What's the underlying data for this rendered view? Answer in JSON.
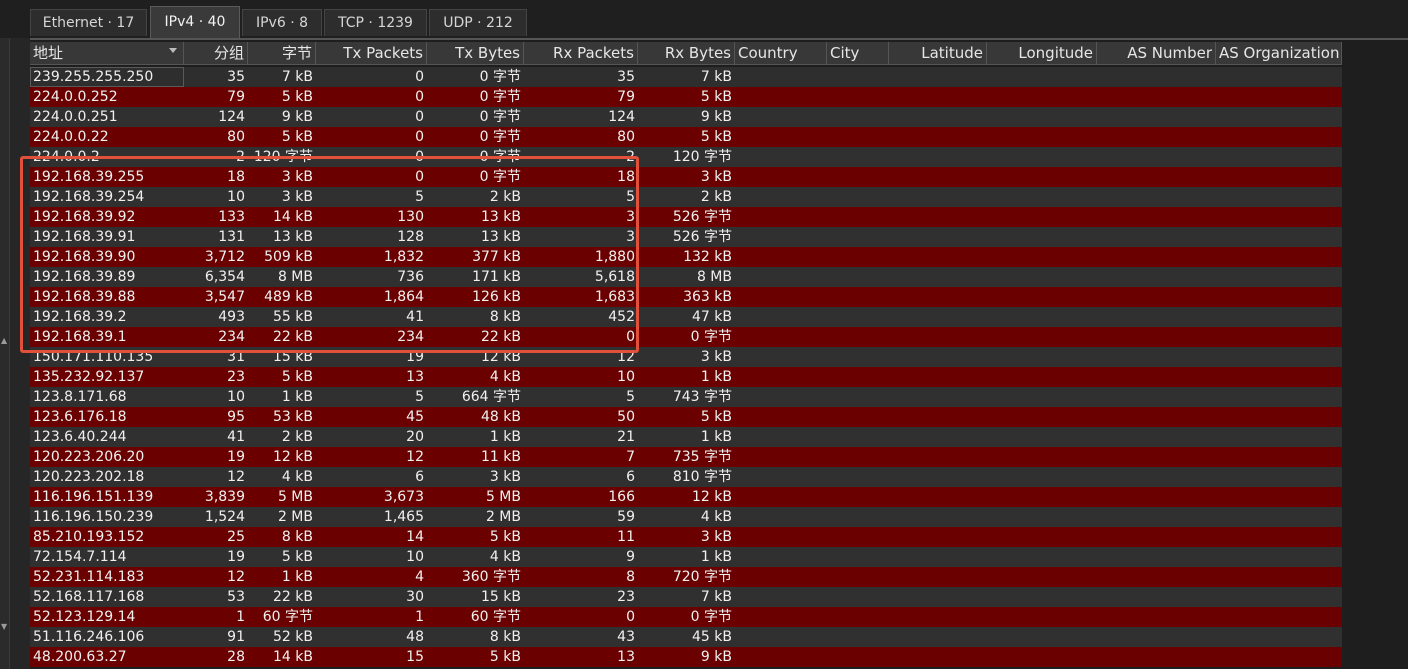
{
  "tabs": [
    {
      "label": "Ethernet · 17"
    },
    {
      "label": "IPv4 · 40"
    },
    {
      "label": "IPv6 · 8"
    },
    {
      "label": "TCP · 1239"
    },
    {
      "label": "UDP · 212"
    }
  ],
  "active_tab": "IPv4 · 40",
  "columns": [
    "地址",
    "分组",
    "字节",
    "Tx Packets",
    "Tx Bytes",
    "Rx Packets",
    "Rx Bytes",
    "Country",
    "City",
    "Latitude",
    "Longitude",
    "AS Number",
    "AS Organization"
  ],
  "sort_column": "地址",
  "sort_direction": "descending",
  "rows": [
    [
      "239.255.255.250",
      "35",
      "7 kB",
      "0",
      "0 字节",
      "35",
      "7 kB"
    ],
    [
      "224.0.0.252",
      "79",
      "5 kB",
      "0",
      "0 字节",
      "79",
      "5 kB"
    ],
    [
      "224.0.0.251",
      "124",
      "9 kB",
      "0",
      "0 字节",
      "124",
      "9 kB"
    ],
    [
      "224.0.0.22",
      "80",
      "5 kB",
      "0",
      "0 字节",
      "80",
      "5 kB"
    ],
    [
      "224.0.0.2",
      "2",
      "120 字节",
      "0",
      "0 字节",
      "2",
      "120 字节"
    ],
    [
      "192.168.39.255",
      "18",
      "3 kB",
      "0",
      "0 字节",
      "18",
      "3 kB"
    ],
    [
      "192.168.39.254",
      "10",
      "3 kB",
      "5",
      "2 kB",
      "5",
      "2 kB"
    ],
    [
      "192.168.39.92",
      "133",
      "14 kB",
      "130",
      "13 kB",
      "3",
      "526 字节"
    ],
    [
      "192.168.39.91",
      "131",
      "13 kB",
      "128",
      "13 kB",
      "3",
      "526 字节"
    ],
    [
      "192.168.39.90",
      "3,712",
      "509 kB",
      "1,832",
      "377 kB",
      "1,880",
      "132 kB"
    ],
    [
      "192.168.39.89",
      "6,354",
      "8 MB",
      "736",
      "171 kB",
      "5,618",
      "8 MB"
    ],
    [
      "192.168.39.88",
      "3,547",
      "489 kB",
      "1,864",
      "126 kB",
      "1,683",
      "363 kB"
    ],
    [
      "192.168.39.2",
      "493",
      "55 kB",
      "41",
      "8 kB",
      "452",
      "47 kB"
    ],
    [
      "192.168.39.1",
      "234",
      "22 kB",
      "234",
      "22 kB",
      "0",
      "0 字节"
    ],
    [
      "150.171.110.135",
      "31",
      "15 kB",
      "19",
      "12 kB",
      "12",
      "3 kB"
    ],
    [
      "135.232.92.137",
      "23",
      "5 kB",
      "13",
      "4 kB",
      "10",
      "1 kB"
    ],
    [
      "123.8.171.68",
      "10",
      "1 kB",
      "5",
      "664 字节",
      "5",
      "743 字节"
    ],
    [
      "123.6.176.18",
      "95",
      "53 kB",
      "45",
      "48 kB",
      "50",
      "5 kB"
    ],
    [
      "123.6.40.244",
      "41",
      "2 kB",
      "20",
      "1 kB",
      "21",
      "1 kB"
    ],
    [
      "120.223.206.20",
      "19",
      "12 kB",
      "12",
      "11 kB",
      "7",
      "735 字节"
    ],
    [
      "120.223.202.18",
      "12",
      "4 kB",
      "6",
      "3 kB",
      "6",
      "810 字节"
    ],
    [
      "116.196.151.139",
      "3,839",
      "5 MB",
      "3,673",
      "5 MB",
      "166",
      "12 kB"
    ],
    [
      "116.196.150.239",
      "1,524",
      "2 MB",
      "1,465",
      "2 MB",
      "59",
      "4 kB"
    ],
    [
      "85.210.193.152",
      "25",
      "8 kB",
      "14",
      "5 kB",
      "11",
      "3 kB"
    ],
    [
      "72.154.7.114",
      "19",
      "5 kB",
      "10",
      "4 kB",
      "9",
      "1 kB"
    ],
    [
      "52.231.114.183",
      "12",
      "1 kB",
      "4",
      "360 字节",
      "8",
      "720 字节"
    ],
    [
      "52.168.117.168",
      "53",
      "22 kB",
      "30",
      "15 kB",
      "23",
      "7 kB"
    ],
    [
      "52.123.129.14",
      "1",
      "60 字节",
      "1",
      "60 字节",
      "0",
      "0 字节"
    ],
    [
      "51.116.246.106",
      "91",
      "52 kB",
      "48",
      "8 kB",
      "43",
      "45 kB"
    ],
    [
      "48.200.63.27",
      "28",
      "14 kB",
      "15",
      "5 kB",
      "13",
      "9 kB"
    ]
  ],
  "highlighted_rows": [
    "192.168.39.255",
    "192.168.39.254",
    "192.168.39.92",
    "192.168.39.91",
    "192.168.39.90",
    "192.168.39.89",
    "192.168.39.88",
    "192.168.39.2",
    "192.168.39.1"
  ],
  "colors": {
    "row_dark": "#303030",
    "row_red": "#6b0000",
    "highlight_border": "#e0503a",
    "header_bg": "#383838"
  }
}
